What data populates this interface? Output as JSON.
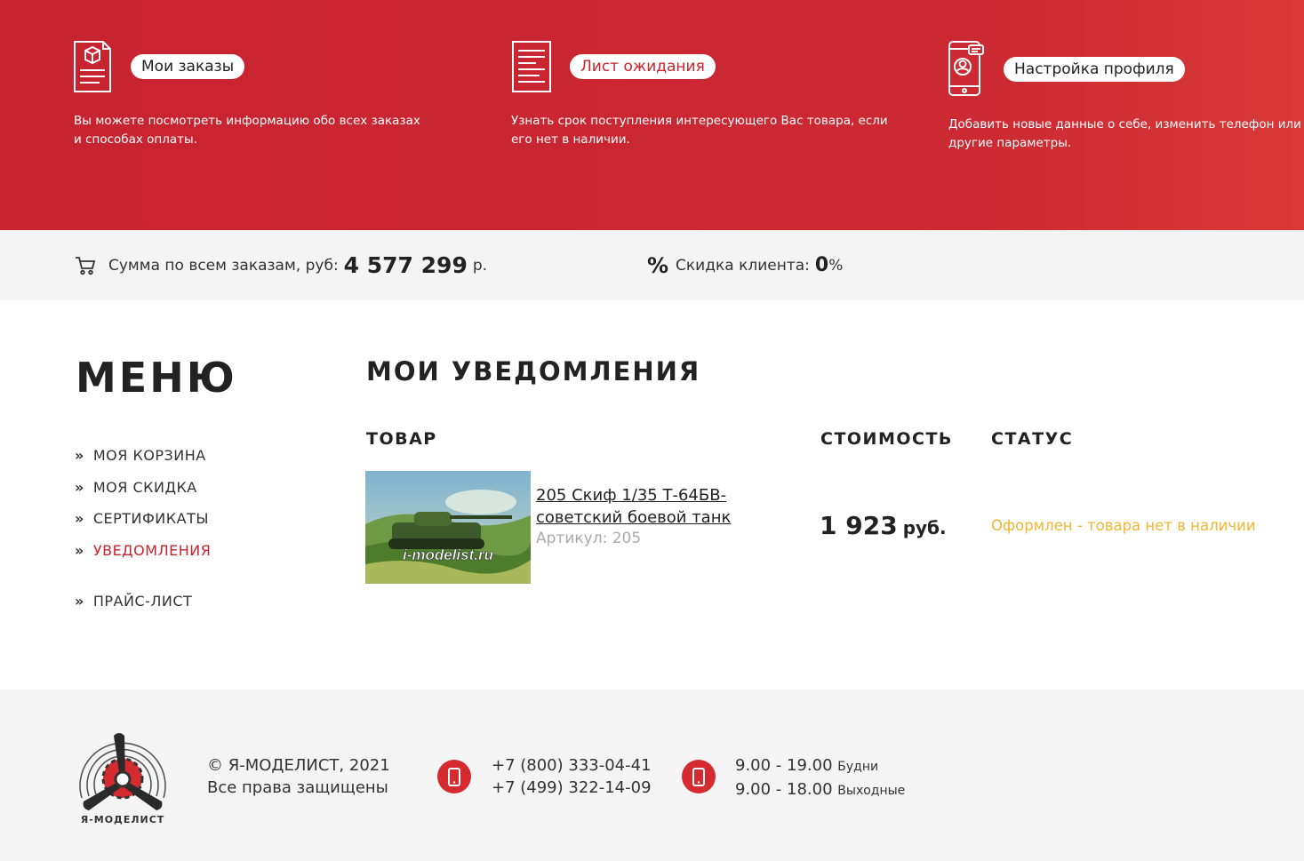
{
  "banner": {
    "orders": {
      "title": "Мои заказы",
      "desc": "Вы можете посмотреть информацию обо всех заказах и способах оплаты.",
      "icon": "document-box-icon"
    },
    "waitlist": {
      "title": "Лист ожидания",
      "desc": "Узнать срок поступления интересующего Вас товара, если его нет в наличии.",
      "icon": "list-document-icon"
    },
    "profile": {
      "title": "Настройка профиля",
      "desc": "Добавить новые данные о себе, изменить телефон или другие параметры.",
      "icon": "phone-profile-icon"
    }
  },
  "stats": {
    "total_label": "Сумма по всем заказам, руб:",
    "total_value": "4 577 299",
    "total_unit": "р.",
    "discount_symbol": "%",
    "discount_label": "Скидка клиента:",
    "discount_value": "0",
    "discount_unit": "%"
  },
  "menu": {
    "title": "МЕНЮ",
    "items": [
      {
        "label": "МОЯ КОРЗИНА",
        "active": false
      },
      {
        "label": "МОЯ СКИДКА",
        "active": false
      },
      {
        "label": "СЕРТИФИКАТЫ",
        "active": false
      },
      {
        "label": "УВЕДОМЛЕНИЯ",
        "active": true
      },
      {
        "label": "ПРАЙС-ЛИСТ",
        "active": false
      }
    ]
  },
  "notifications": {
    "title": "МОИ УВЕДОМЛЕНИЯ",
    "columns": {
      "product": "ТОВАР",
      "price": "СТОИМОСТЬ",
      "status": "СТАТУС"
    },
    "rows": [
      {
        "name": "205 Скиф 1/35 Т-64БВ-советский боевой танк",
        "sku": "Артикул: 205",
        "thumb_watermark": "i-modelist.ru",
        "price": "1 923",
        "currency": "руб.",
        "status": "Оформлен - товара нет в наличии"
      }
    ]
  },
  "footer": {
    "copyright": "© Я-МОДЕЛИСТ, 2021",
    "rights": "Все права защищены",
    "phones": [
      "+7 (800) 333-04-41",
      "+7 (499) 322-14-09"
    ],
    "hours": [
      {
        "time": "9.00 - 19.00",
        "label": "Будни"
      },
      {
        "time": "9.00 - 18.00",
        "label": "Выходные"
      }
    ],
    "logo_text": "Я-МОДЕЛИСТ"
  },
  "colors": {
    "brand_red": "#c9232e",
    "status_orange": "#f3b530",
    "panel_gray": "#f4f4f4"
  }
}
